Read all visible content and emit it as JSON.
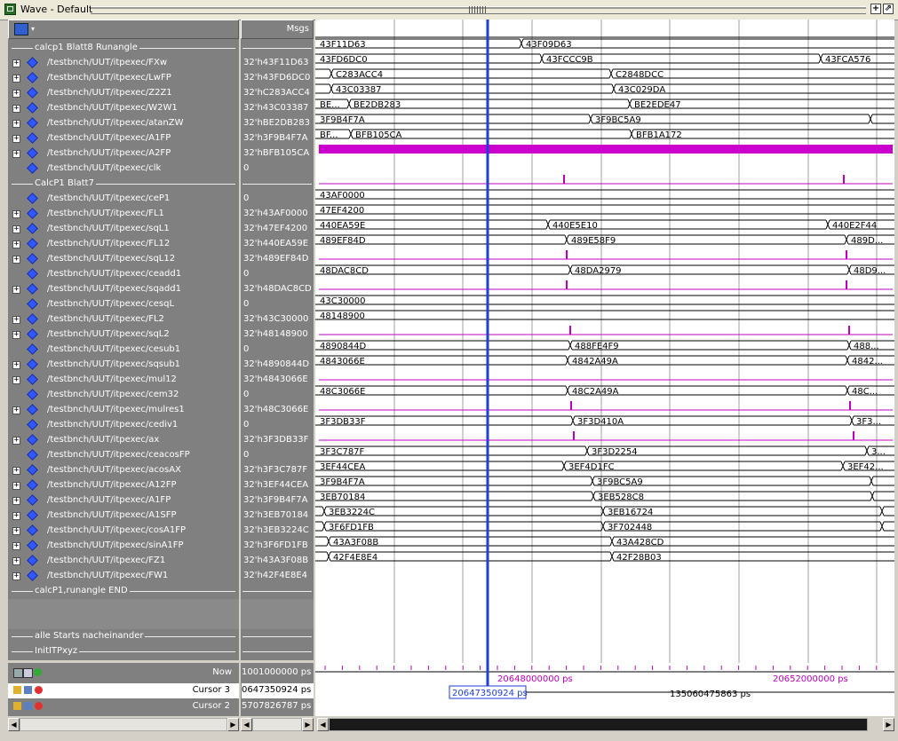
{
  "window": {
    "title": "Wave - Default"
  },
  "header": {
    "msgs": "Msgs"
  },
  "groups": [
    {
      "kind": "divider",
      "label": "calcp1 Blatt8 Runangle"
    },
    {
      "kind": "sig",
      "expand": true,
      "name": "/testbnch/UUT/itpexec/FXw",
      "value": "32'h43F11D63",
      "segs": [
        [
          "43F11D63",
          0,
          232
        ],
        [
          "43F09D63",
          232,
          650
        ]
      ]
    },
    {
      "kind": "sig",
      "expand": true,
      "name": "/testbnch/UUT/itpexec/LwFP",
      "value": "32'h43FD6DC0",
      "segs": [
        [
          "43FD6DC0",
          0,
          255
        ],
        [
          "43FCCC9B",
          255,
          569
        ],
        [
          "43FCA576",
          569,
          650
        ]
      ]
    },
    {
      "kind": "sig",
      "expand": true,
      "name": "/testbnch/UUT/itpexec/Z2Z1",
      "value": "32'hC283ACC4",
      "segs": [
        [
          "",
          0,
          18
        ],
        [
          "C283ACC4",
          18,
          333
        ],
        [
          "C2848DCC",
          333,
          650
        ]
      ]
    },
    {
      "kind": "sig",
      "expand": true,
      "name": "/testbnch/UUT/itpexec/W2W1",
      "value": "32'h43C03387",
      "segs": [
        [
          "",
          0,
          18
        ],
        [
          "43C03387",
          18,
          336
        ],
        [
          "43C029DA",
          336,
          650
        ]
      ]
    },
    {
      "kind": "sig",
      "expand": true,
      "name": "/testbnch/UUT/itpexec/atanZW",
      "value": "32'hBE2DB283",
      "segs": [
        [
          "BE...",
          0,
          38
        ],
        [
          "BE2DB283",
          38,
          354
        ],
        [
          "BE2EDE47",
          354,
          650
        ]
      ]
    },
    {
      "kind": "sig",
      "expand": true,
      "name": "/testbnch/UUT/itpexec/A1FP",
      "value": "32'h3F9B4F7A",
      "segs": [
        [
          "3F9B4F7A",
          0,
          310
        ],
        [
          "3F9BC5A9",
          310,
          625
        ],
        [
          "",
          625,
          650
        ]
      ]
    },
    {
      "kind": "sig",
      "expand": true,
      "name": "/testbnch/UUT/itpexec/A2FP",
      "value": "32'hBFB105CA",
      "segs": [
        [
          "BF...",
          0,
          40
        ],
        [
          "BFB105CA",
          40,
          356
        ],
        [
          "BFB1A172",
          356,
          650
        ]
      ]
    },
    {
      "kind": "clk",
      "expand": false,
      "name": "/testbnch/UUT/itpexec/clk",
      "value": "0"
    },
    {
      "kind": "divider",
      "label": "CalcP1 Blatt7"
    },
    {
      "kind": "bit",
      "expand": false,
      "name": "/testbnch/UUT/itpexec/ceP1",
      "value": "0",
      "pulses": [
        280,
        595
      ]
    },
    {
      "kind": "sig",
      "expand": true,
      "name": "/testbnch/UUT/itpexec/FL1",
      "value": "32'h43AF0000",
      "segs": [
        [
          "43AF0000",
          0,
          650
        ]
      ]
    },
    {
      "kind": "sig",
      "expand": true,
      "name": "/testbnch/UUT/itpexec/sqL1",
      "value": "32'h47EF4200",
      "segs": [
        [
          "47EF4200",
          0,
          650
        ]
      ]
    },
    {
      "kind": "sig",
      "expand": true,
      "name": "/testbnch/UUT/itpexec/FL12",
      "value": "32'h440EA59E",
      "segs": [
        [
          "440EA59E",
          0,
          262
        ],
        [
          "440E5E10",
          262,
          577
        ],
        [
          "440E2F44",
          577,
          650
        ]
      ]
    },
    {
      "kind": "sig",
      "expand": true,
      "name": "/testbnch/UUT/itpexec/sqL12",
      "value": "32'h489EF84D",
      "segs": [
        [
          "489EF84D",
          0,
          283
        ],
        [
          "489E58F9",
          283,
          598
        ],
        [
          "489D...",
          598,
          650
        ]
      ]
    },
    {
      "kind": "bit",
      "expand": false,
      "name": "/testbnch/UUT/itpexec/ceadd1",
      "value": "0",
      "pulses": [
        283,
        598
      ]
    },
    {
      "kind": "sig",
      "expand": true,
      "name": "/testbnch/UUT/itpexec/sqadd1",
      "value": "32'h48DAC8CD",
      "segs": [
        [
          "48DAC8CD",
          0,
          287
        ],
        [
          "48DA2979",
          287,
          601
        ],
        [
          "48D9...",
          601,
          650
        ]
      ]
    },
    {
      "kind": "bit",
      "expand": false,
      "name": "/testbnch/UUT/itpexec/cesqL",
      "value": "0",
      "pulses": [
        283,
        598
      ]
    },
    {
      "kind": "sig",
      "expand": true,
      "name": "/testbnch/UUT/itpexec/FL2",
      "value": "32'h43C30000",
      "segs": [
        [
          "43C30000",
          0,
          650
        ]
      ]
    },
    {
      "kind": "sig",
      "expand": true,
      "name": "/testbnch/UUT/itpexec/sqL2",
      "value": "32'h48148900",
      "segs": [
        [
          "48148900",
          0,
          650
        ]
      ]
    },
    {
      "kind": "bit",
      "expand": false,
      "name": "/testbnch/UUT/itpexec/cesub1",
      "value": "0",
      "pulses": [
        287,
        601
      ]
    },
    {
      "kind": "sig",
      "expand": true,
      "name": "/testbnch/UUT/itpexec/sqsub1",
      "value": "32'h4890844D",
      "segs": [
        [
          "4890844D",
          0,
          287
        ],
        [
          "488FE4F9",
          287,
          601
        ],
        [
          "488...",
          601,
          650
        ]
      ]
    },
    {
      "kind": "sig",
      "expand": true,
      "name": "/testbnch/UUT/itpexec/mul12",
      "value": "32'h4843066E",
      "segs": [
        [
          "4843066E",
          0,
          284
        ],
        [
          "4842A49A",
          284,
          599
        ],
        [
          "4842...",
          599,
          650
        ]
      ]
    },
    {
      "kind": "bit",
      "expand": false,
      "name": "/testbnch/UUT/itpexec/cem32",
      "value": "0",
      "pulses": []
    },
    {
      "kind": "sig",
      "expand": true,
      "name": "/testbnch/UUT/itpexec/mulres1",
      "value": "32'h48C3066E",
      "segs": [
        [
          "48C3066E",
          0,
          284
        ],
        [
          "48C2A49A",
          284,
          599
        ],
        [
          "48C...",
          599,
          650
        ]
      ]
    },
    {
      "kind": "bit",
      "expand": false,
      "name": "/testbnch/UUT/itpexec/cediv1",
      "value": "0",
      "pulses": [
        288,
        602
      ]
    },
    {
      "kind": "sig",
      "expand": true,
      "name": "/testbnch/UUT/itpexec/ax",
      "value": "32'h3F3DB33F",
      "segs": [
        [
          "3F3DB33F",
          0,
          290
        ],
        [
          "3F3D410A",
          290,
          604
        ],
        [
          "3F3...",
          604,
          650
        ]
      ]
    },
    {
      "kind": "bit",
      "expand": false,
      "name": "/testbnch/UUT/itpexec/ceacosFP",
      "value": "0",
      "pulses": [
        291,
        606
      ]
    },
    {
      "kind": "sig",
      "expand": true,
      "name": "/testbnch/UUT/itpexec/acosAX",
      "value": "32'h3F3C787F",
      "segs": [
        [
          "3F3C787F",
          0,
          306
        ],
        [
          "3F3D2254",
          306,
          621
        ],
        [
          "3...",
          621,
          650
        ]
      ]
    },
    {
      "kind": "sig",
      "expand": true,
      "name": "/testbnch/UUT/itpexec/A12FP",
      "value": "32'h3EF44CEA",
      "segs": [
        [
          "3EF44CEA",
          0,
          280
        ],
        [
          "3EF4D1FC",
          280,
          594
        ],
        [
          "3EF42...",
          594,
          650
        ]
      ]
    },
    {
      "kind": "sig",
      "expand": true,
      "name": "/testbnch/UUT/itpexec/A1FP",
      "value": "32'h3F9B4F7A",
      "segs": [
        [
          "3F9B4F7A",
          0,
          312
        ],
        [
          "3F9BC5A9",
          312,
          626
        ],
        [
          "",
          626,
          650
        ]
      ]
    },
    {
      "kind": "sig",
      "expand": true,
      "name": "/testbnch/UUT/itpexec/A1SFP",
      "value": "32'h3EB70184",
      "segs": [
        [
          "3EB70184",
          0,
          313
        ],
        [
          "3EB528C8",
          313,
          627
        ],
        [
          "",
          627,
          650
        ]
      ]
    },
    {
      "kind": "sig",
      "expand": true,
      "name": "/testbnch/UUT/itpexec/cosA1FP",
      "value": "32'h3EB3224C",
      "segs": [
        [
          "",
          0,
          10
        ],
        [
          "3EB3224C",
          10,
          324
        ],
        [
          "3EB16724",
          324,
          638
        ],
        [
          "",
          638,
          650
        ]
      ]
    },
    {
      "kind": "sig",
      "expand": true,
      "name": "/testbnch/UUT/itpexec/sinA1FP",
      "value": "32'h3F6FD1FB",
      "segs": [
        [
          "",
          0,
          10
        ],
        [
          "3F6FD1FB",
          10,
          324
        ],
        [
          "3F702448",
          324,
          638
        ],
        [
          "",
          638,
          650
        ]
      ]
    },
    {
      "kind": "sig",
      "expand": true,
      "name": "/testbnch/UUT/itpexec/FZ1",
      "value": "32'h43A3F08B",
      "segs": [
        [
          "",
          0,
          15
        ],
        [
          "43A3F08B",
          15,
          334
        ],
        [
          "43A428CD",
          334,
          650
        ]
      ]
    },
    {
      "kind": "sig",
      "expand": true,
      "name": "/testbnch/UUT/itpexec/FW1",
      "value": "32'h42F4E8E4",
      "segs": [
        [
          "",
          0,
          15
        ],
        [
          "42F4E8E4",
          15,
          334
        ],
        [
          "42F28B03",
          334,
          650
        ]
      ]
    },
    {
      "kind": "divider",
      "label": "calcP1,runangle END"
    },
    {
      "kind": "blank"
    },
    {
      "kind": "blank"
    },
    {
      "kind": "divider",
      "label": "alle Starts nacheinander"
    },
    {
      "kind": "divider",
      "label": "InitITPxyz"
    }
  ],
  "bottom": {
    "now_label": "Now",
    "now_value": "1001000000 ps",
    "cursor3_label": "Cursor 3",
    "cursor3_value": "0647350924 ps",
    "cursor2_label": "Cursor 2",
    "cursor2_value": "5707826787 ps",
    "tick1": "20648000000 ps",
    "tick2": "20652000000 ps",
    "cursor_readout": "20647350924 ps",
    "delta_readout": "135060475863 ps"
  },
  "colors": {
    "panel": "#808080",
    "wave": "#c000c0",
    "cursor": "#1f3fd6",
    "grid": "#a0a0a0",
    "clk": "#cc00cc"
  }
}
